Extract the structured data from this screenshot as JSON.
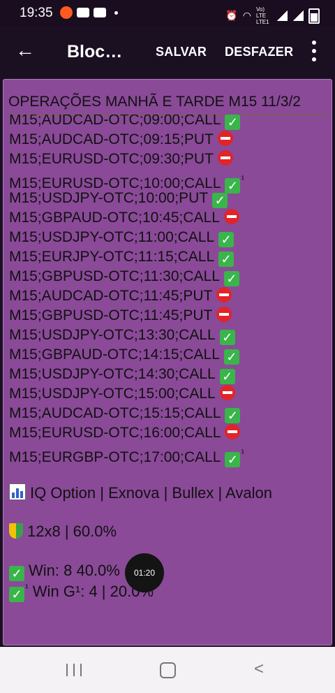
{
  "status_bar": {
    "time": "19:35",
    "lte_label": "Vo) LTE LTE1"
  },
  "app_bar": {
    "title": "Bloco...",
    "save_label": "SALVAR",
    "undo_label": "DESFAZER"
  },
  "note": {
    "title": "OPERAÇÕES MANHÃ E TARDE M15 11/3/2",
    "lines": [
      {
        "text": "M15;AUDCAD-OTC;09:00;CALL",
        "mark": "check",
        "sup": ""
      },
      {
        "text": "M15;AUDCAD-OTC;09:15;PUT",
        "mark": "stop",
        "sup": ""
      },
      {
        "text": "M15;EURUSD-OTC;09:30;PUT",
        "mark": "stop",
        "sup": ""
      },
      {
        "text": "M15;EURUSD-OTC;10:00;CALL",
        "mark": "check",
        "sup": "¹"
      },
      {
        "text": "M15;USDJPY-OTC;10:00;PUT",
        "mark": "check",
        "sup": ""
      },
      {
        "text": "M15;GBPAUD-OTC;10:45;CALL",
        "mark": "stop",
        "sup": ""
      },
      {
        "text": "M15;USDJPY-OTC;11:00;CALL",
        "mark": "check",
        "sup": ""
      },
      {
        "text": "M15;EURJPY-OTC;11:15;CALL",
        "mark": "check",
        "sup": ""
      },
      {
        "text": "M15;GBPUSD-OTC;11:30;CALL",
        "mark": "check",
        "sup": ""
      },
      {
        "text": "M15;AUDCAD-OTC;11:45;PUT",
        "mark": "stop",
        "sup": ""
      },
      {
        "text": "M15;GBPUSD-OTC;11:45;PUT",
        "mark": "stop",
        "sup": ""
      },
      {
        "text": "M15;USDJPY-OTC;13:30;CALL",
        "mark": "check",
        "sup": ""
      },
      {
        "text": "M15;GBPAUD-OTC;14:15;CALL",
        "mark": "check",
        "sup": ""
      },
      {
        "text": "M15;USDJPY-OTC;14:30;CALL",
        "mark": "check",
        "sup": ""
      },
      {
        "text": "M15;USDJPY-OTC;15:00;CALL",
        "mark": "stop",
        "sup": ""
      },
      {
        "text": "M15;AUDCAD-OTC;15:15;CALL",
        "mark": "check",
        "sup": ""
      },
      {
        "text": "M15;EURUSD-OTC;16:00;CALL",
        "mark": "stop",
        "sup": ""
      },
      {
        "text": "M15;EURGBP-OTC;17:00;CALL",
        "mark": "check",
        "sup": "¹"
      }
    ],
    "brokers": "IQ Option | Exnova | Bullex | Avalon",
    "score": "12x8 | 60.0%",
    "win": "Win: 8 40.0%",
    "win_g1": "Win G¹: 4 | 20.0%",
    "win_g1_mark_sup": "¹"
  },
  "timer_overlay": "01:20",
  "colors": {
    "note_background": "#8a4a98",
    "app_bar": "#1b0f22",
    "check": "#39b54a",
    "stop": "#e0242a"
  }
}
